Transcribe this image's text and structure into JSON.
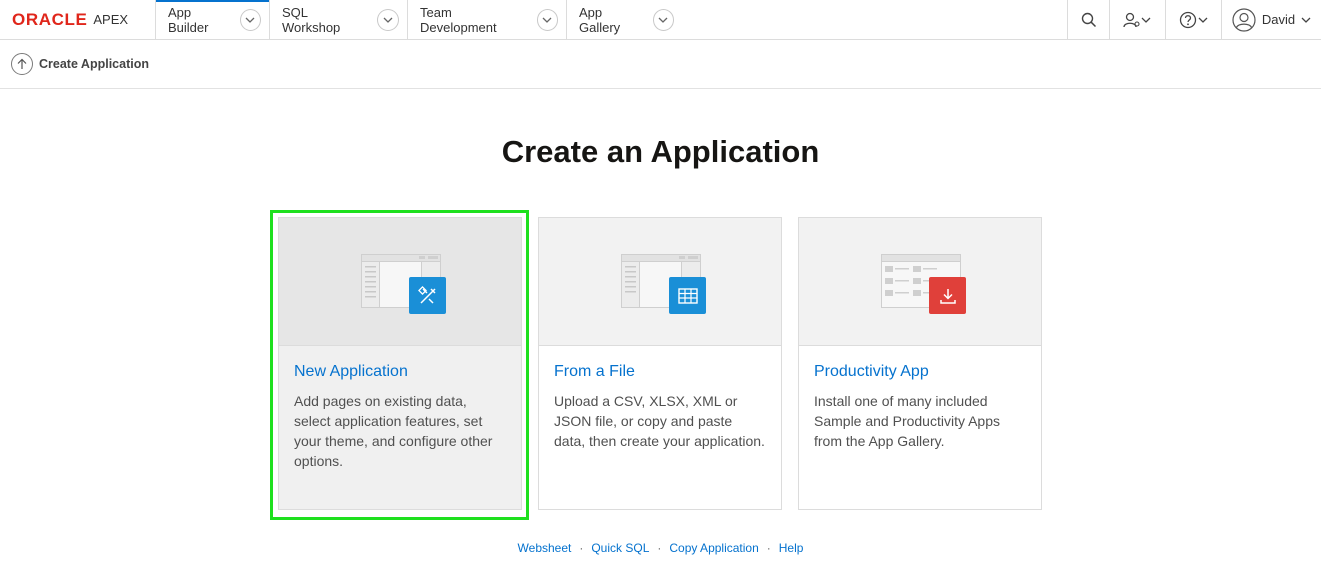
{
  "brand": {
    "oracle": "ORACLE",
    "apex": "APEX"
  },
  "nav": {
    "tabs": [
      {
        "label": "App Builder"
      },
      {
        "label": "SQL Workshop"
      },
      {
        "label": "Team Development"
      },
      {
        "label": "App Gallery"
      }
    ],
    "user_name": "David"
  },
  "breadcrumb": {
    "label": "Create Application"
  },
  "main": {
    "title": "Create an Application",
    "cards": [
      {
        "title": "New Application",
        "description": "Add pages on existing data, select application features, set your theme, and configure other options.",
        "badge_color": "#1a8fd7",
        "icon": "wizard-icon"
      },
      {
        "title": "From a File",
        "description": "Upload a CSV, XLSX, XML or JSON file, or copy and paste data, then create your application.",
        "badge_color": "#1a8fd7",
        "icon": "table-grid-icon"
      },
      {
        "title": "Productivity App",
        "description": "Install one of many included Sample and Productivity Apps from the App Gallery.",
        "badge_color": "#e0403a",
        "icon": "download-icon"
      }
    ]
  },
  "footer": {
    "links": [
      "Websheet",
      "Quick SQL",
      "Copy Application",
      "Help"
    ],
    "separator": "·"
  },
  "colors": {
    "accent": "#0572ce",
    "brand_red": "#e0261b",
    "highlight": "#1ee01e"
  }
}
